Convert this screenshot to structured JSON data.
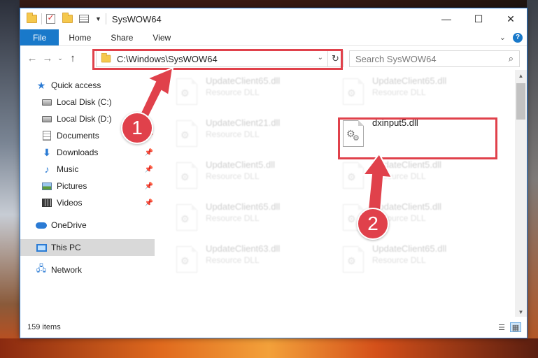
{
  "titlebar": {
    "title": "SysWOW64",
    "minimize": "—",
    "maximize": "☐",
    "close": "✕"
  },
  "ribbon": {
    "tabs": [
      "File",
      "Home",
      "Share",
      "View"
    ],
    "help": "?"
  },
  "navbar": {
    "back": "←",
    "forward": "→",
    "recent": "⌄",
    "up": "↑",
    "address": "C:\\Windows\\SysWOW64",
    "search_placeholder": "Search SysWOW64"
  },
  "sidebar": {
    "items": [
      {
        "label": "Quick access",
        "icon": "star-icon"
      },
      {
        "label": "Local Disk (C:)",
        "icon": "disk-icon",
        "pinned": true
      },
      {
        "label": "Local Disk (D:)",
        "icon": "disk-icon",
        "pinned": true
      },
      {
        "label": "Documents",
        "icon": "documents-icon",
        "pinned": true
      },
      {
        "label": "Downloads",
        "icon": "downloads-icon",
        "pinned": true
      },
      {
        "label": "Music",
        "icon": "music-icon",
        "pinned": true
      },
      {
        "label": "Pictures",
        "icon": "pictures-icon",
        "pinned": true
      },
      {
        "label": "Videos",
        "icon": "videos-icon",
        "pinned": true
      },
      {
        "label": "OneDrive",
        "icon": "onedrive-icon"
      },
      {
        "label": "This PC",
        "icon": "pc-icon",
        "selected": true
      },
      {
        "label": "Network",
        "icon": "network-icon"
      }
    ]
  },
  "files": [
    {
      "name": "UpdateClient65.dll",
      "type": "Resource DLL",
      "faded": true
    },
    {
      "name": "UpdateClient65.dll",
      "type": "Resource DLL",
      "faded": true
    },
    {
      "name": "UpdateClient21.dll",
      "type": "Resource DLL",
      "faded": true
    },
    {
      "name": "dxinput5.dll",
      "type": "",
      "faded": false,
      "highlighted": true
    },
    {
      "name": "UpdateClient5.dll",
      "type": "Resource DLL",
      "faded": true
    },
    {
      "name": "UpdateClient5.dll",
      "type": "Resource DLL",
      "faded": true
    },
    {
      "name": "UpdateClient65.dll",
      "type": "Resource DLL",
      "faded": true
    },
    {
      "name": "UpdateClient5.dll",
      "type": "Resource DLL",
      "faded": true
    },
    {
      "name": "UpdateClient63.dll",
      "type": "Resource DLL",
      "faded": true
    },
    {
      "name": "UpdateClient65.dll",
      "type": "Resource DLL",
      "faded": true
    }
  ],
  "status": {
    "item_count": "159 items"
  },
  "annotations": {
    "step1": "1",
    "step2": "2",
    "color": "#e0414b"
  },
  "colors": {
    "accent": "#1979ca",
    "highlight_box": "#e0414b"
  }
}
